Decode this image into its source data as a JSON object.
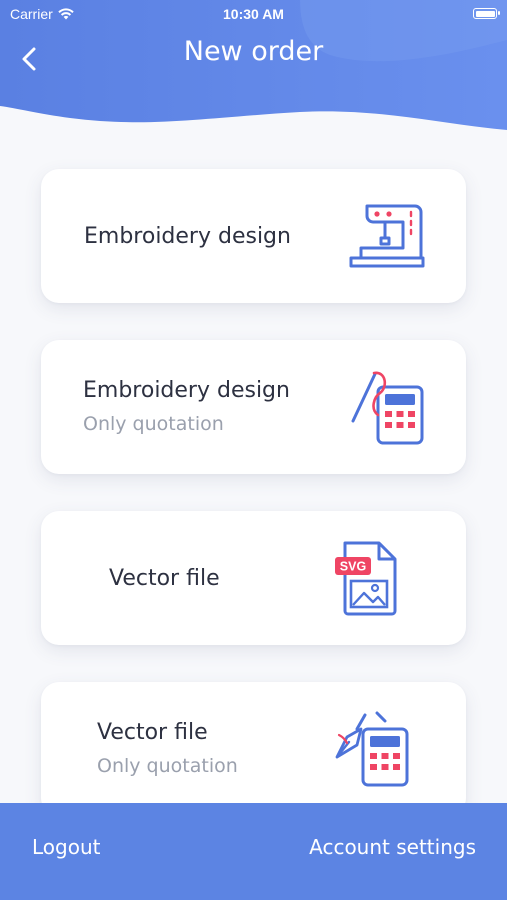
{
  "status_bar": {
    "carrier": "Carrier",
    "time": "10:30 AM",
    "battery_level": 1.0
  },
  "header": {
    "title": "New order",
    "back_icon": "chevron-left-icon"
  },
  "cards": [
    {
      "label": "Embroidery design",
      "sublabel": "",
      "icon": "sewing-machine-icon"
    },
    {
      "label": "Embroidery design",
      "sublabel": "Only quotation",
      "icon": "needle-calculator-icon"
    },
    {
      "label": "Vector file",
      "sublabel": "",
      "icon": "svg-file-icon",
      "icon_badge": "SVG"
    },
    {
      "label": "Vector file",
      "sublabel": "Only quotation",
      "icon": "pen-calculator-icon"
    }
  ],
  "bottom_bar": {
    "logout_label": "Logout",
    "account_settings_label": "Account settings"
  },
  "colors": {
    "primary": "#5c84e3",
    "icon_blue": "#4d73d9",
    "icon_red": "#ef4564",
    "background": "#f7f8fb"
  }
}
